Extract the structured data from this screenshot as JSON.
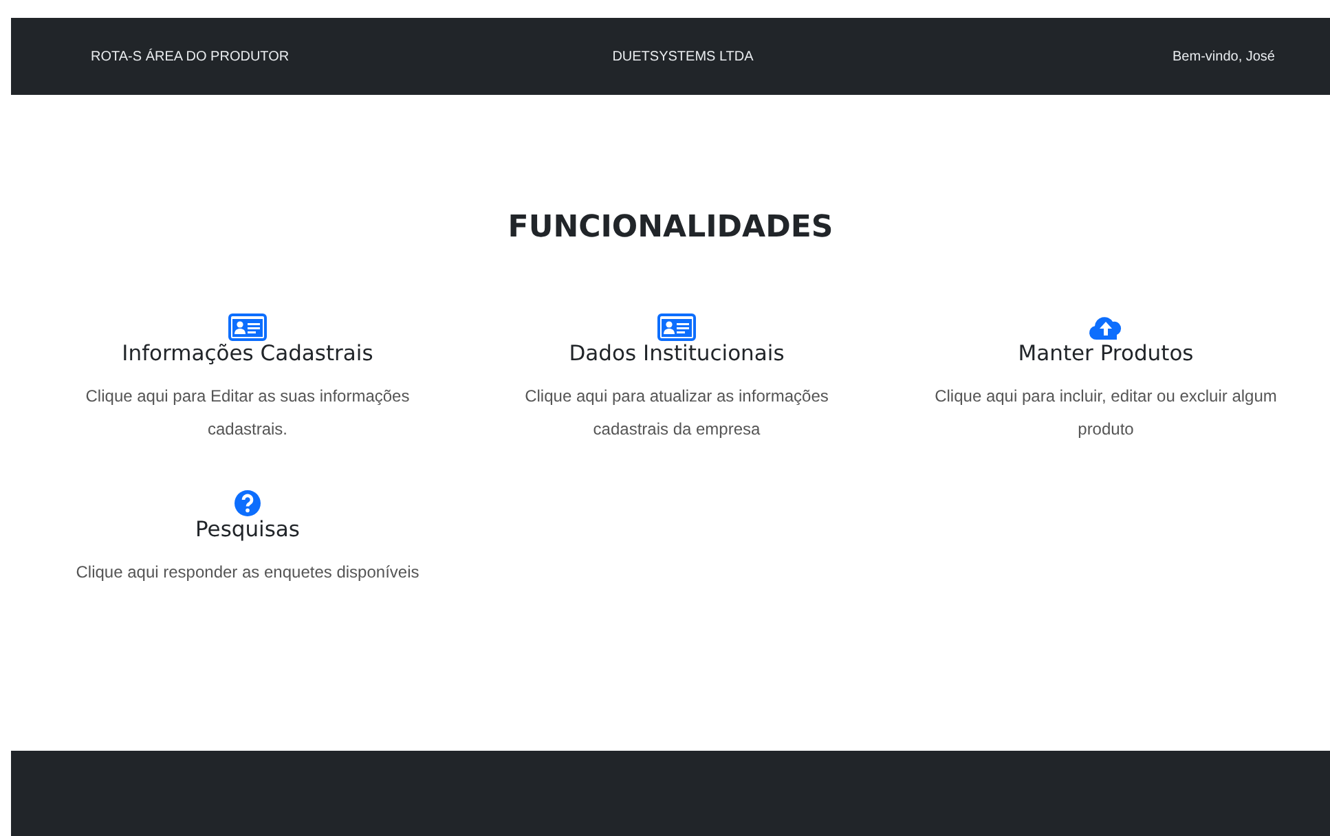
{
  "header": {
    "brand": "ROTA-S ÁREA DO PRODUTOR",
    "company": "DUETSYSTEMS LTDA",
    "greeting": "Bem-vindo, José"
  },
  "section": {
    "title": "FUNCIONALIDADES"
  },
  "features": [
    {
      "kind": "card",
      "title": "Informações Cadastrais",
      "description": "Clique aqui para Editar as suas informações cadastrais."
    },
    {
      "kind": "card",
      "title": "Dados Institucionais",
      "description": "Clique aqui para atualizar as informações cadastrais da empresa"
    },
    {
      "kind": "upload",
      "title": "Manter Produtos",
      "description": "Clique aqui para incluir, editar ou excluir algum produto"
    },
    {
      "kind": "help",
      "title": "Pesquisas",
      "description": "Clique aqui responder as enquetes disponíveis"
    }
  ]
}
